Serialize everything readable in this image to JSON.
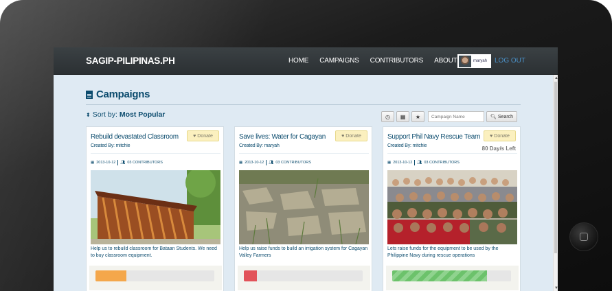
{
  "site": {
    "brand": "SAGIP-PILIPINAS.PH",
    "nav": [
      "HOME",
      "CAMPAIGNS",
      "CONTRIBUTORS",
      "ABOUT US"
    ],
    "user": "maryah",
    "logout": "LOG OUT"
  },
  "page": {
    "title": "Campaigns",
    "sort_label": "Sort by:",
    "sort_value": "Most Popular",
    "search_placeholder": "Campaign Name",
    "search_button": "Search"
  },
  "icons": [
    "file-icon",
    "sort-icon",
    "clock-icon",
    "calendar-icon",
    "star-icon",
    "search-icon",
    "heart-icon",
    "users-icon"
  ],
  "colors": {
    "accent": "#0c4c6e",
    "navbar": "#2f3437",
    "background": "#dfeaf3",
    "donate": "#fbf0bf"
  },
  "campaigns": [
    {
      "title": "Rebuild devastated Classroom",
      "created_by": "Created By: mitchie",
      "date": "2013-10-12",
      "contributors": "03 CONTRIBUTORS",
      "description": "Help us to rebuild classroom for Bataan Students. We need to buy classroom equipment.",
      "donate": "Donate",
      "days_left": "",
      "progress": 0.26,
      "progress_color": "#f4a74b"
    },
    {
      "title": "Save lives: Water for Cagayan",
      "created_by": "Created By: maryah",
      "date": "2013-10-12",
      "contributors": "03 CONTRIBUTORS",
      "description": "Help us raise funds to build an irrigation system for Cagayan Valley Farmers",
      "donate": "Donate",
      "days_left": "",
      "progress": 0.11,
      "progress_color": "#e2535a"
    },
    {
      "title": "Support Phil Navy Rescue Team",
      "created_by": "Created By: mitchie",
      "date": "2013-10-12",
      "contributors": "03 CONTRIBUTORS",
      "description": "Lets raise funds for the equipment to be used by the Philippine Navy during rescue operations",
      "donate": "Donate",
      "days_left": "80 Day/s Left",
      "progress": 0.8,
      "progress_color": "#6cc26b"
    }
  ]
}
